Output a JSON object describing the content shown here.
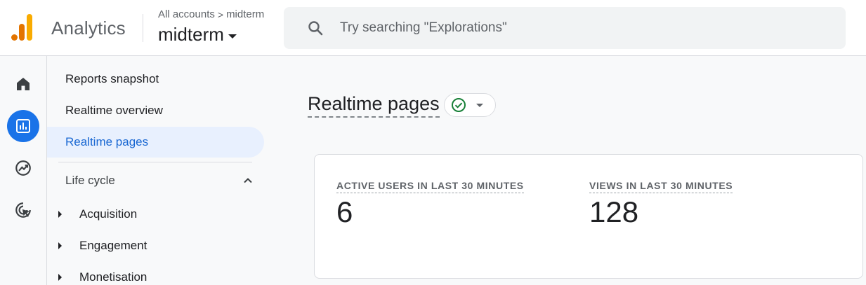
{
  "header": {
    "app_name": "Analytics",
    "breadcrumb": {
      "parent": "All accounts",
      "separator": ">",
      "current": "midterm"
    },
    "property_name": "midterm",
    "search": {
      "placeholder": "Try searching \"Explorations\"",
      "value": ""
    }
  },
  "rail": {
    "items": [
      {
        "name": "home",
        "icon": "home-icon",
        "active": false
      },
      {
        "name": "reports",
        "icon": "reports-icon",
        "active": true
      },
      {
        "name": "explore",
        "icon": "explore-icon",
        "active": false
      },
      {
        "name": "advertising",
        "icon": "advertising-icon",
        "active": false
      }
    ]
  },
  "nav": {
    "items": [
      {
        "label": "Reports snapshot",
        "active": false
      },
      {
        "label": "Realtime overview",
        "active": false
      },
      {
        "label": "Realtime pages",
        "active": true
      }
    ],
    "section": {
      "label": "Life cycle",
      "expanded": true
    },
    "tree": [
      {
        "label": "Acquisition"
      },
      {
        "label": "Engagement"
      },
      {
        "label": "Monetisation"
      }
    ]
  },
  "main": {
    "title": "Realtime pages",
    "status": {
      "icon": "check-circle-icon",
      "color": "#188038"
    },
    "metrics": [
      {
        "label": "ACTIVE USERS IN LAST 30 MINUTES",
        "value": "6"
      },
      {
        "label": "VIEWS IN LAST 30 MINUTES",
        "value": "128"
      }
    ]
  },
  "colors": {
    "accent": "#1a73e8",
    "active_nav_bg": "#e8f0fe",
    "active_nav_text": "#1967d2",
    "success": "#188038"
  }
}
